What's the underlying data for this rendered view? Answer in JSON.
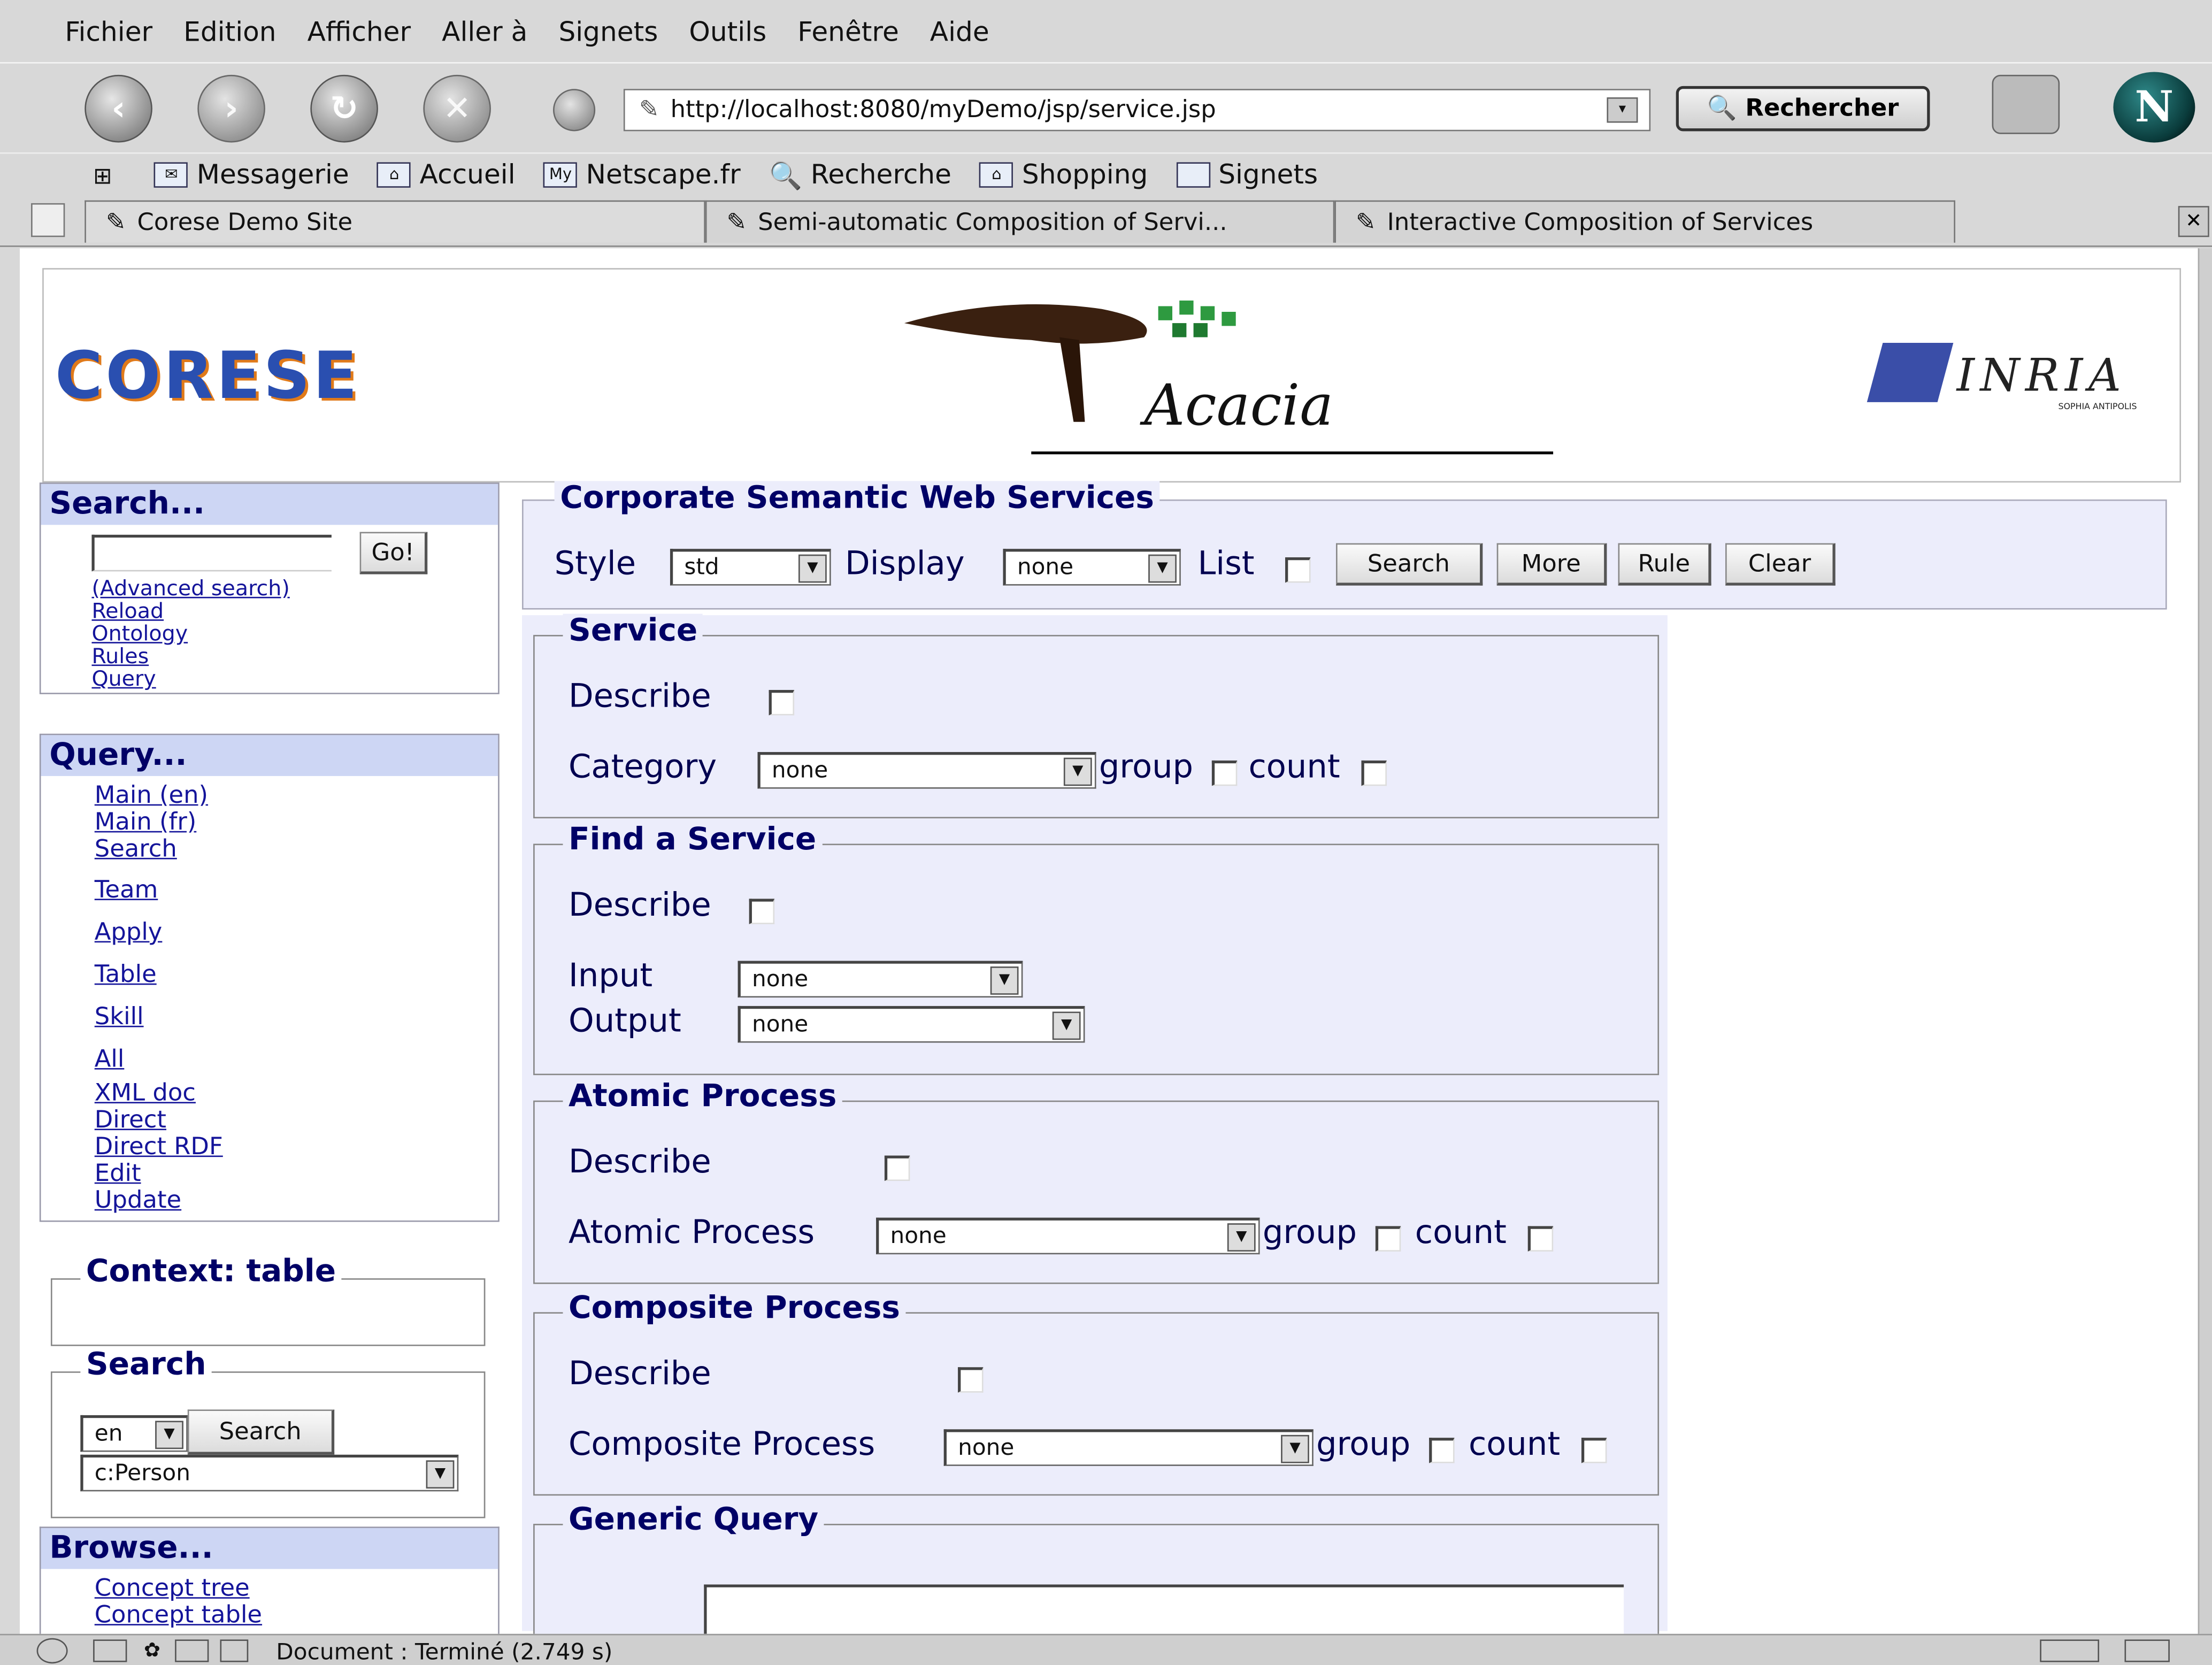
{
  "menu": [
    "Fichier",
    "Edition",
    "Afficher",
    "Aller à",
    "Signets",
    "Outils",
    "Fenêtre",
    "Aide"
  ],
  "nav": {
    "url": "http://localhost:8080/myDemo/jsp/service.jsp",
    "search_label": "Rechercher"
  },
  "personal_toolbar": [
    "Messagerie",
    "Accueil",
    "Netscape.fr",
    "Recherche",
    "Shopping",
    "Signets"
  ],
  "tabs": [
    "Corese Demo Site",
    "Semi-automatic Composition of Servi...",
    "Interactive Composition of Services"
  ],
  "banner": {
    "left_logo": "CORESE",
    "center_logo": "Acacia",
    "right_logo": "INRIA",
    "right_logo_sub": "SOPHIA ANTIPOLIS"
  },
  "sidebar": {
    "search": {
      "title": "Search...",
      "go_label": "Go!",
      "links": [
        "(Advanced search)",
        "Reload",
        "Ontology",
        "Rules",
        "Query"
      ]
    },
    "query": {
      "title": "Query...",
      "links": [
        "Main (en)",
        "Main (fr)",
        "Search",
        "Team",
        "Apply",
        "Table",
        "Skill",
        "All",
        "XML doc",
        "Direct",
        "Direct RDF",
        "Edit",
        "Update"
      ]
    },
    "context": {
      "title": "Context: table"
    },
    "search2": {
      "title": "Search",
      "lang": "en",
      "button": "Search",
      "concept": "c:Person"
    },
    "browse": {
      "title": "Browse...",
      "links": [
        "Concept tree",
        "Concept table"
      ]
    }
  },
  "main": {
    "header": {
      "title": "Corporate Semantic Web Services",
      "style_label": "Style",
      "style_value": "std",
      "display_label": "Display",
      "display_value": "none",
      "list_label": "List",
      "buttons": [
        "Search",
        "More",
        "Rule",
        "Clear"
      ]
    },
    "service": {
      "title": "Service",
      "describe": "Describe",
      "category_label": "Category",
      "category_value": "none",
      "group": "group",
      "count": "count"
    },
    "find": {
      "title": "Find a Service",
      "describe": "Describe",
      "input_label": "Input",
      "input_value": "none",
      "output_label": "Output",
      "output_value": "none"
    },
    "atomic": {
      "title": "Atomic Process",
      "describe": "Describe",
      "label": "Atomic Process",
      "value": "none",
      "group": "group",
      "count": "count"
    },
    "composite": {
      "title": "Composite Process",
      "describe": "Describe",
      "label": "Composite Process",
      "value": "none",
      "group": "group",
      "count": "count"
    },
    "generic": {
      "title": "Generic Query"
    }
  },
  "status": {
    "text": "Document : Terminé (2.749 s)"
  },
  "colors": {
    "accent": "#000066",
    "header_bg": "#cdd6f4",
    "form_bg": "#ecedfb",
    "link": "#14149a"
  }
}
